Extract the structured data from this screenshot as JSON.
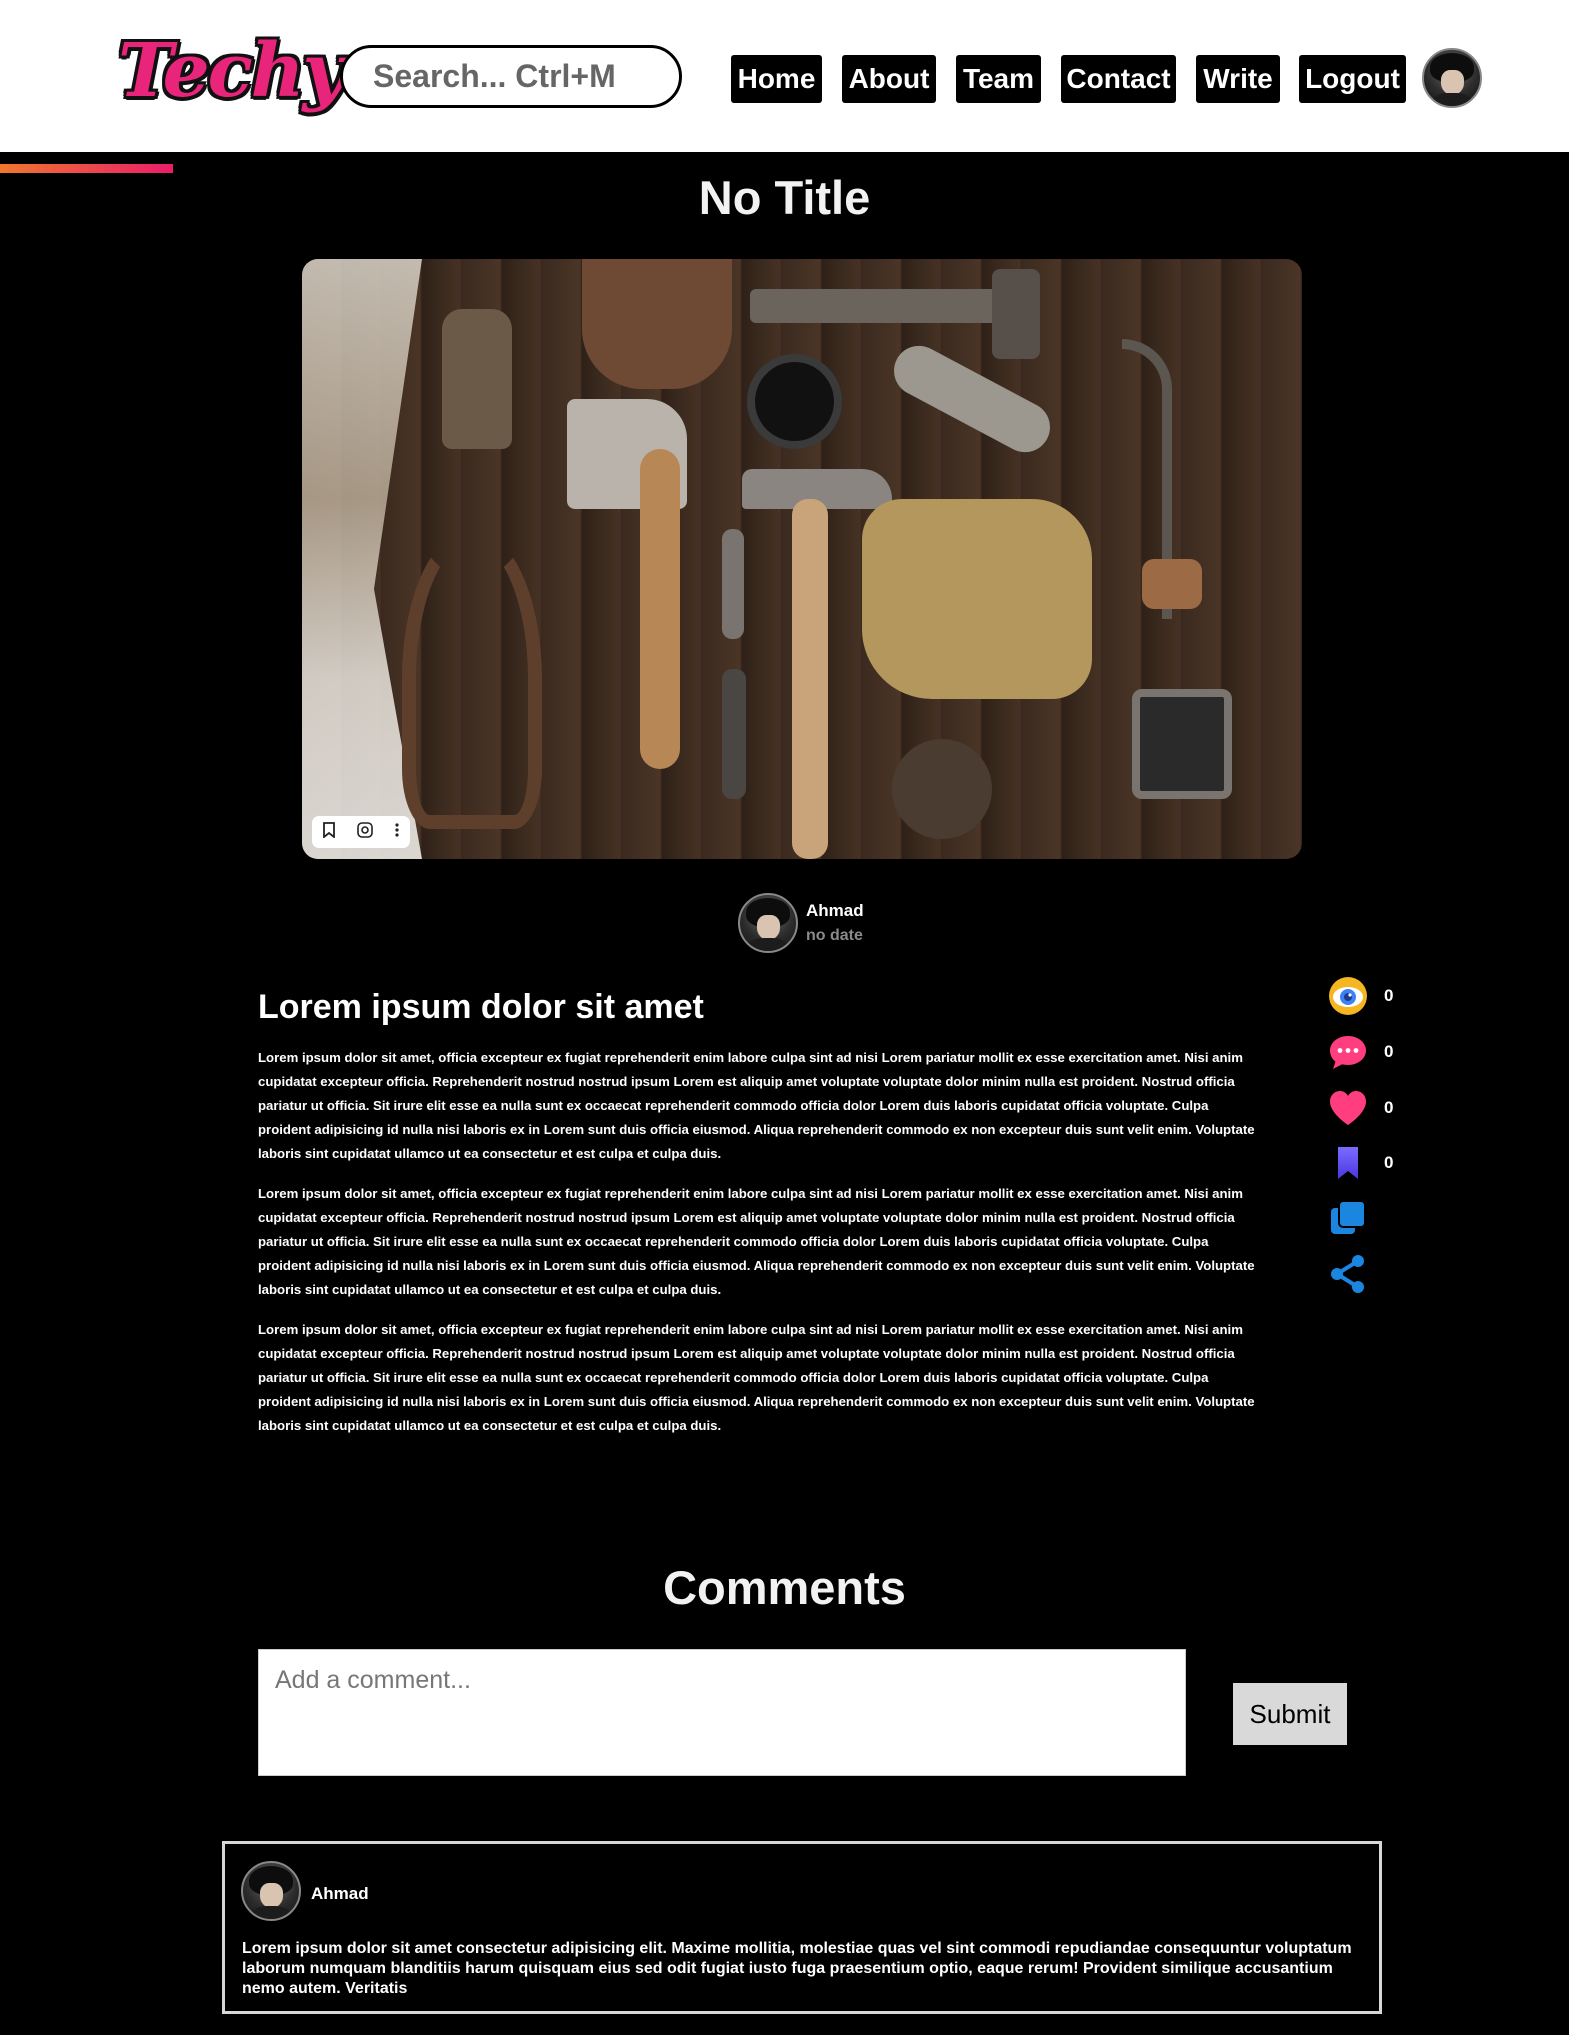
{
  "header": {
    "logo": "Techy",
    "search_placeholder": "Search... Ctrl+M",
    "nav": [
      "Home",
      "About",
      "Team",
      "Contact",
      "Write",
      "Logout"
    ]
  },
  "reading_progress": 0.11,
  "post": {
    "title": "No Title",
    "image_alt": "Old tools on a wooden table",
    "author": "Ahmad",
    "date": "no date",
    "heading": "Lorem ipsum dolor sit amet",
    "paragraphs": [
      "Lorem ipsum dolor sit amet, officia excepteur ex fugiat reprehenderit enim labore culpa sint ad nisi Lorem pariatur mollit ex esse exercitation amet. Nisi anim cupidatat excepteur officia. Reprehenderit nostrud nostrud ipsum Lorem est aliquip amet voluptate voluptate dolor minim nulla est proident. Nostrud officia pariatur ut officia. Sit irure elit esse ea nulla sunt ex occaecat reprehenderit commodo officia dolor Lorem duis laboris cupidatat officia voluptate. Culpa proident adipisicing id nulla nisi laboris ex in Lorem sunt duis officia eiusmod. Aliqua reprehenderit commodo ex non excepteur duis sunt velit enim. Voluptate laboris sint cupidatat ullamco ut ea consectetur et est culpa et culpa duis.",
      "Lorem ipsum dolor sit amet, officia excepteur ex fugiat reprehenderit enim labore culpa sint ad nisi Lorem pariatur mollit ex esse exercitation amet. Nisi anim cupidatat excepteur officia. Reprehenderit nostrud nostrud ipsum Lorem est aliquip amet voluptate voluptate dolor minim nulla est proident. Nostrud officia pariatur ut officia. Sit irure elit esse ea nulla sunt ex occaecat reprehenderit commodo officia dolor Lorem duis laboris cupidatat officia voluptate. Culpa proident adipisicing id nulla nisi laboris ex in Lorem sunt duis officia eiusmod. Aliqua reprehenderit commodo ex non excepteur duis sunt velit enim. Voluptate laboris sint cupidatat ullamco ut ea consectetur et est culpa et culpa duis.",
      "Lorem ipsum dolor sit amet, officia excepteur ex fugiat reprehenderit enim labore culpa sint ad nisi Lorem pariatur mollit ex esse exercitation amet. Nisi anim cupidatat excepteur officia. Reprehenderit nostrud nostrud ipsum Lorem est aliquip amet voluptate voluptate dolor minim nulla est proident. Nostrud officia pariatur ut officia. Sit irure elit esse ea nulla sunt ex occaecat reprehenderit commodo officia dolor Lorem duis laboris cupidatat officia voluptate. Culpa proident adipisicing id nulla nisi laboris ex in Lorem sunt duis officia eiusmod. Aliqua reprehenderit commodo ex non excepteur duis sunt velit enim. Voluptate laboris sint cupidatat ullamco ut ea consectetur et est culpa et culpa duis."
    ],
    "stats": {
      "views": "0",
      "comments": "0",
      "likes": "0",
      "bookmarks": "0"
    }
  },
  "comments": {
    "title": "Comments",
    "placeholder": "Add a comment...",
    "submit_label": "Submit",
    "items": [
      {
        "author": "Ahmad",
        "text": "Lorem ipsum dolor sit amet consectetur adipisicing elit. Maxime mollitia, molestiae quas vel sint commodi repudiandae consequuntur voluptatum laborum numquam blanditiis harum quisquam eius sed odit fugiat iusto fuga praesentium optio, eaque rerum! Provident similique accusantium nemo autem. Veritatis"
      }
    ]
  },
  "colors": {
    "brand_pink": "#e8257a",
    "progress_start": "#f0772d",
    "progress_end": "#ea1d6a",
    "like_pink": "#ff3d7f",
    "bookmark_purple": "#6a5cff",
    "action_blue": "#1a86e0"
  },
  "icons": {
    "views": "eye-icon",
    "comments": "chat-bubble-icon",
    "likes": "heart-icon",
    "bookmarks": "bookmark-icon",
    "copy": "copy-icon",
    "share": "share-icon",
    "image_toolbar": [
      "bookmark-icon",
      "lens-icon",
      "more-vertical-icon"
    ]
  }
}
